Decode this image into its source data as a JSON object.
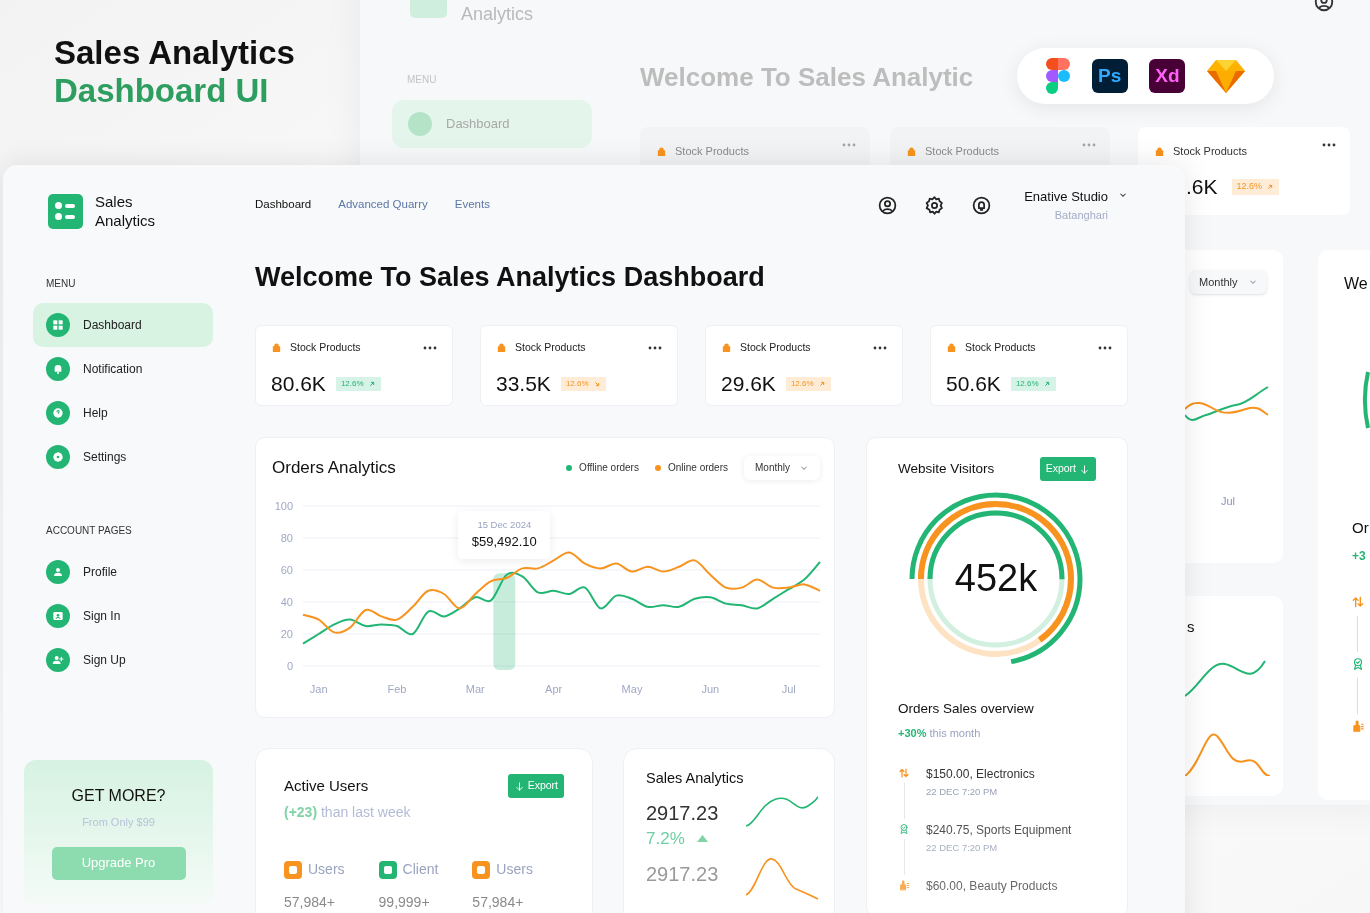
{
  "promo": {
    "title": "Sales Analytics",
    "subtitle": "Dashboard UI"
  },
  "tools": [
    {
      "kind": "figma"
    },
    {
      "kind": "photoshop",
      "label": "Ps"
    },
    {
      "kind": "xd",
      "label": "Xd"
    },
    {
      "kind": "sketch"
    }
  ],
  "background_window": {
    "brand": "Analytics",
    "menu_heading": "MENU",
    "menu_items": [
      {
        "label": "Dashboard",
        "selected": true
      }
    ],
    "title": "Welcome To Sales Analytic",
    "stat_cards": [
      {
        "label": "Stock Products"
      },
      {
        "label": "Stock Products"
      },
      {
        "label": "Stock Products",
        "value": ".6K",
        "change": "12.6%",
        "rising": true,
        "color": "#f7931e"
      }
    ],
    "chart": {
      "period": "Monthly",
      "month": "Jul"
    },
    "sparkline_card": {
      "title": "s"
    },
    "visitors_card": {
      "title": "We",
      "subtitle": "Or",
      "change": "+3",
      "timeline": [
        {
          "kind": "transfer"
        },
        {
          "kind": "award"
        },
        {
          "kind": "hand"
        }
      ]
    }
  },
  "app": {
    "brand": "Sales Analytics",
    "nav": [
      {
        "label": "Dashboard",
        "selected": true
      },
      {
        "label": "Advanced Quarry",
        "selected": false
      },
      {
        "label": "Events",
        "selected": false
      }
    ],
    "user": {
      "name": "Enative Studio",
      "location": "Batanghari"
    },
    "sidebar": [
      {
        "heading": "MENU",
        "items": [
          {
            "label": "Dashboard",
            "kind": "grid",
            "selected": true
          },
          {
            "label": "Notification",
            "kind": "bell",
            "selected": false
          },
          {
            "label": "Help",
            "kind": "help",
            "selected": false
          },
          {
            "label": "Settings",
            "kind": "gear",
            "selected": false
          }
        ]
      },
      {
        "heading": "ACCOUNT PAGES",
        "items": [
          {
            "label": "Profile",
            "kind": "user",
            "selected": false
          },
          {
            "label": "Sign In",
            "kind": "card",
            "selected": false
          },
          {
            "label": "Sign Up",
            "kind": "user-plus",
            "selected": false
          }
        ]
      }
    ],
    "promo_card": {
      "title": "GET MORE?",
      "subtitle": "From Only $99",
      "button": "Upgrade Pro"
    },
    "title": "Welcome To Sales Analytics Dashboard",
    "stat_cards": [
      {
        "label": "Stock Products",
        "value": "80.6K",
        "change": "12.6%",
        "rising": true,
        "color": "#22b573"
      },
      {
        "label": "Stock Products",
        "value": "33.5K",
        "change": "12.6%",
        "rising": false,
        "color": "#f7931e"
      },
      {
        "label": "Stock Products",
        "value": "29.6K",
        "change": "12.6%",
        "rising": true,
        "color": "#f7931e"
      },
      {
        "label": "Stock Products",
        "value": "50.6K",
        "change": "12.6%",
        "rising": true,
        "color": "#22b573"
      }
    ],
    "orders": {
      "title": "Orders Analytics",
      "period": "Monthly",
      "tooltip": {
        "date": "15 Dec 2024",
        "value": "$59,492.10"
      },
      "chart_data": {
        "type": "line",
        "categories": [
          null,
          "Jan",
          null,
          null,
          null,
          null,
          "Feb",
          null,
          null,
          null,
          null,
          "Mar",
          null,
          null,
          null,
          null,
          "Apr",
          null,
          null,
          null,
          null,
          "May",
          null,
          null,
          null,
          null,
          "Jun",
          null,
          null,
          null,
          null,
          "Jul",
          null,
          null
        ],
        "series": [
          {
            "name": "Offline orders",
            "color": "#22b573",
            "values": [
              14,
              20,
              26,
              29,
              25,
              26,
              25,
              20,
              34,
              31,
              36,
              43,
              41,
              57,
              56,
              46,
              47,
              45,
              49,
              36,
              44,
              42,
              37,
              38,
              37,
              42,
              43,
              39,
              38,
              36,
              42,
              48,
              54,
              65
            ]
          },
          {
            "name": "Online orders",
            "color": "#f7931e",
            "values": [
              32,
              29,
              21,
              24,
              35,
              31,
              29,
              37,
              47,
              45,
              36,
              45,
              53,
              55,
              61,
              61,
              66,
              71,
              64,
              61,
              64,
              59,
              62,
              59,
              62,
              66,
              57,
              49,
              49,
              54,
              49,
              49,
              51,
              47
            ]
          }
        ],
        "ylim": [
          0,
          100
        ],
        "grid": true,
        "yticks": [
          0,
          20,
          40,
          60,
          80,
          100
        ]
      }
    },
    "visitors": {
      "title": "Website Visitors",
      "action": "Export",
      "value": "452k",
      "overview_title": "Orders Sales overview",
      "overview_change": "**+30%** this month",
      "timeline": [
        {
          "kind": "transfer",
          "title": "$150.00, Electronics",
          "time": "22 DEC 7:20 PM"
        },
        {
          "kind": "award",
          "title": "$240.75, Sports Equipment",
          "time": "22 DEC 7:20 PM"
        },
        {
          "kind": "hand",
          "title": "$60.00, Beauty Products"
        }
      ]
    },
    "active_users": {
      "title": "Active Users",
      "action": "Export",
      "subtitle": "**(+23)** than last week",
      "stats": [
        {
          "label": "Users",
          "value": "57,984+",
          "color": "#f7931e"
        },
        {
          "label": "Client",
          "value": "99,999+",
          "color": "#22b573"
        },
        {
          "label": "Users",
          "value": "57,984+",
          "color": "#f7931e"
        }
      ]
    },
    "sales": {
      "title": "Sales Analytics",
      "rows": [
        {
          "value": "2917.23",
          "change": "7.2%",
          "rising": true,
          "color": "#22b573"
        },
        {
          "value": "2917.23",
          "color": "#f7931e"
        }
      ]
    }
  }
}
